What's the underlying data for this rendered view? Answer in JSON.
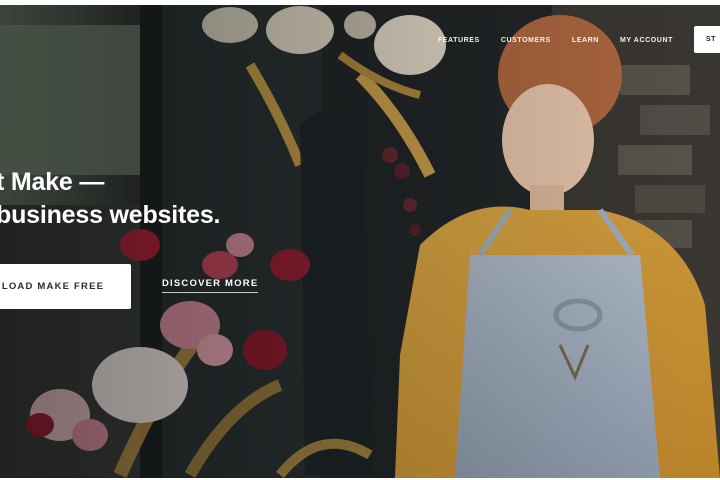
{
  "nav": {
    "links": [
      "FEATURES",
      "CUSTOMERS",
      "LEARN",
      "MY ACCOUNT"
    ],
    "cta_partial": "ST"
  },
  "hero": {
    "headline_line1": "t Make —",
    "headline_line2": "business websites.",
    "primary_button_partial": "ILOAD MAKE FREE",
    "secondary_button": "DISCOVER MORE",
    "image_subject": "florist-in-apron-with-flowers"
  },
  "colors": {
    "text_light": "#ffffff",
    "button_bg": "#ffffff",
    "button_text": "#2b2b2b",
    "sweater": "#e0a63e",
    "apron": "#a8b6c7"
  }
}
